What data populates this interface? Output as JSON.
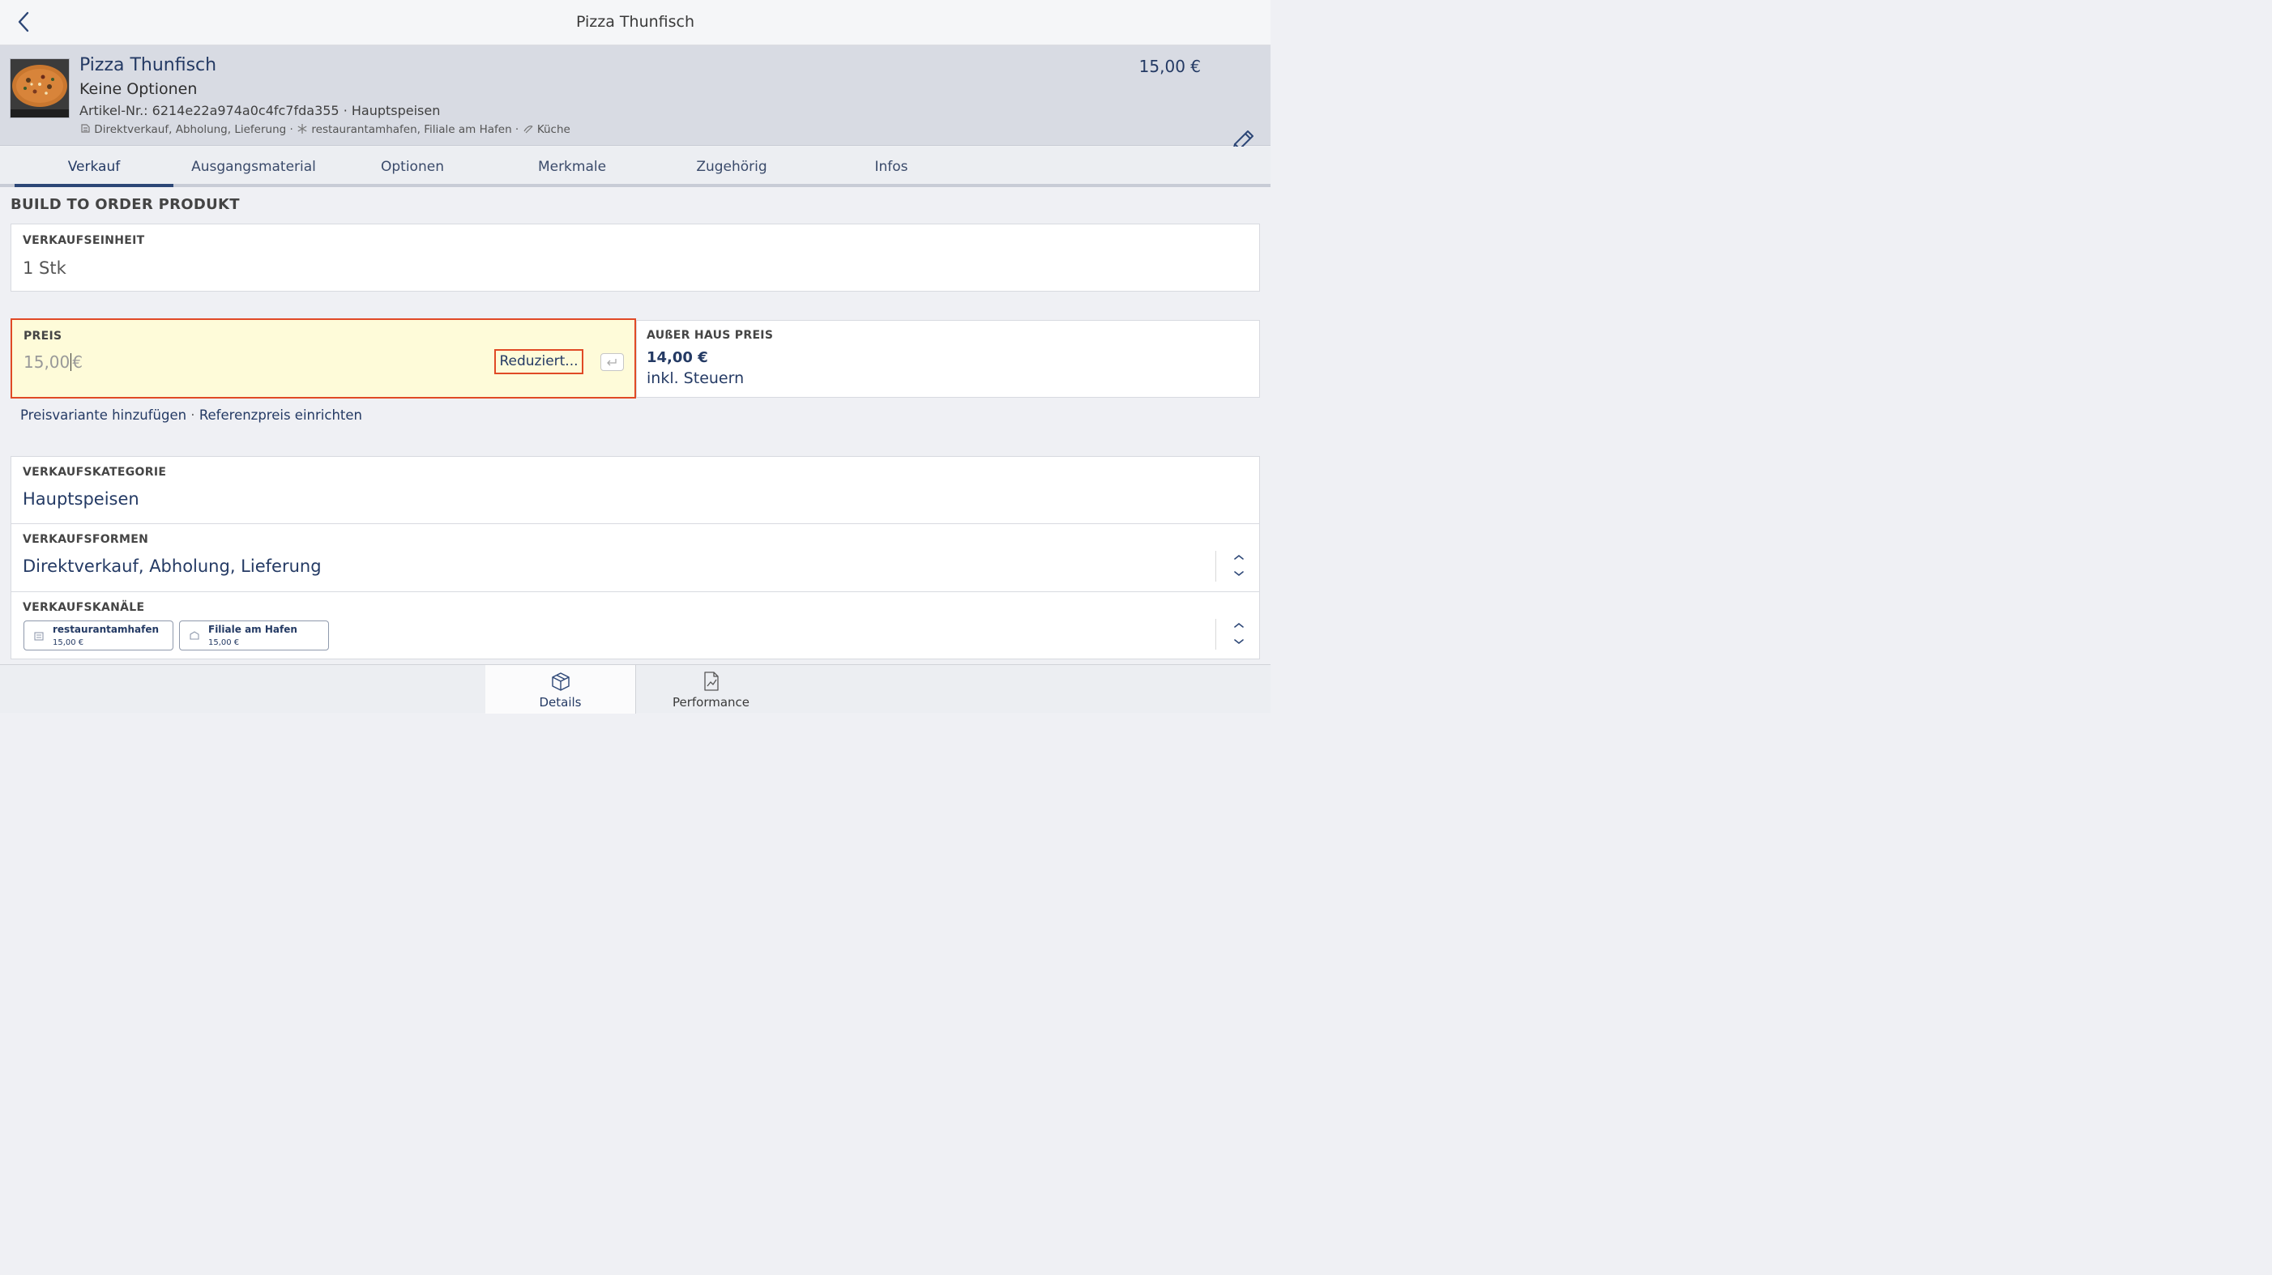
{
  "nav": {
    "title": "Pizza Thunfisch"
  },
  "header": {
    "name": "Pizza Thunfisch",
    "options": "Keine Optionen",
    "article": "Artikel-Nr.: 6214e22a974a0c4fc7fda355 · Hauptspeisen",
    "meta_forms": "Direktverkauf, Abholung, Lieferung",
    "meta_sep1": " · ",
    "meta_channels": "restaurantamhafen, Filiale am Hafen",
    "meta_sep2": " · ",
    "meta_kitchen": "Küche",
    "price": "15,00 €"
  },
  "tabs": [
    "Verkauf",
    "Ausgangsmaterial",
    "Optionen",
    "Merkmale",
    "Zugehörig",
    "Infos"
  ],
  "section_title": "BUILD TO ORDER PRODUKT",
  "unit": {
    "label": "VERKAUFSEINHEIT",
    "value": "1 Stk"
  },
  "price": {
    "label": "PREIS",
    "value_before_caret": "15,00",
    "value_after_caret": "€",
    "reduced_button": "Reduziert..."
  },
  "takeaway": {
    "label": "AUßER HAUS PREIS",
    "value": "14,00 €",
    "note": "inkl. Steuern"
  },
  "links": {
    "add_variant": "Preisvariante hinzufügen",
    "sep": " · ",
    "reference": "Referenzpreis einrichten"
  },
  "category": {
    "label": "VERKAUFSKATEGORIE",
    "value": "Hauptspeisen"
  },
  "forms": {
    "label": "VERKAUFSFORMEN",
    "value": "Direktverkauf, Abholung, Lieferung"
  },
  "channels": {
    "label": "VERKAUFSKANÄLE",
    "items": [
      {
        "name": "restaurantamhafen",
        "price": "15,00 €"
      },
      {
        "name": "Filiale am Hafen",
        "price": "15,00 €"
      }
    ]
  },
  "bottom_tabs": {
    "details": "Details",
    "performance": "Performance"
  },
  "colors": {
    "accent": "#243a64",
    "highlight": "#e04a26",
    "price_bg": "#fefbd9"
  }
}
